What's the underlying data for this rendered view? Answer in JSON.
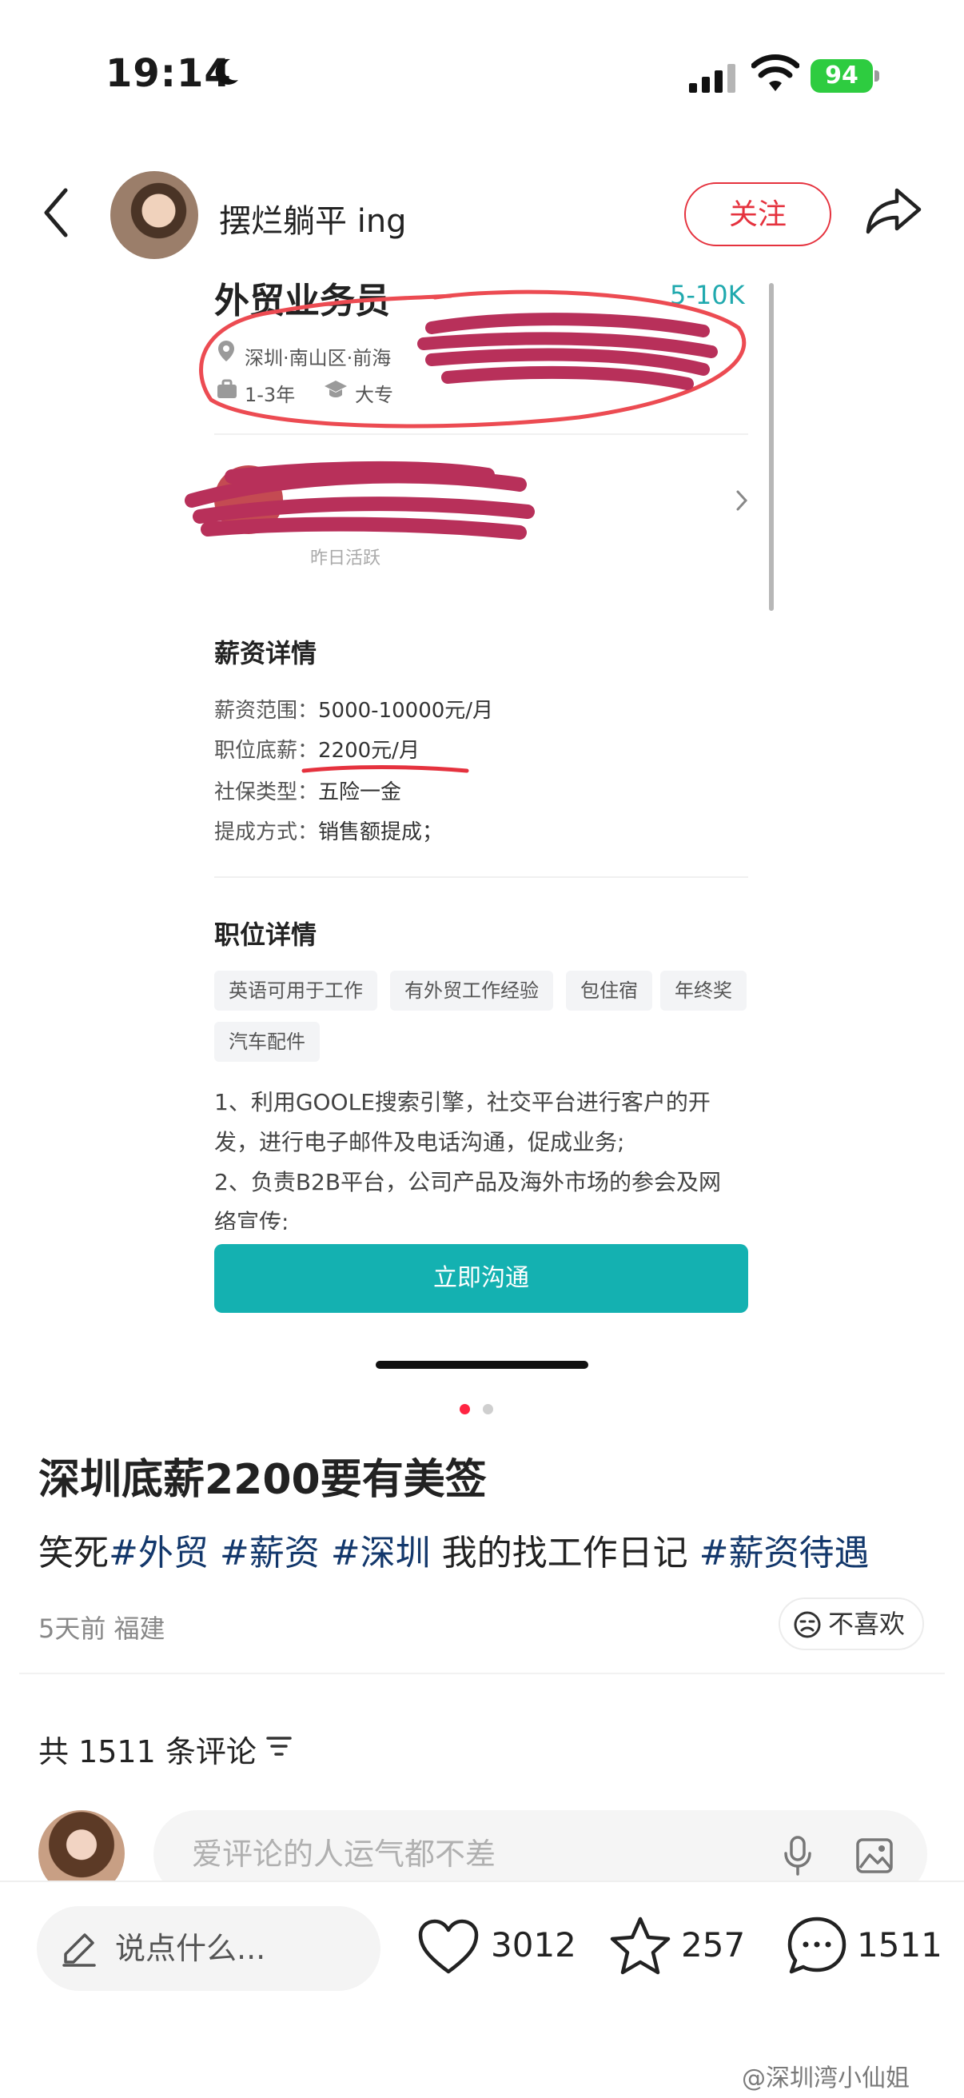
{
  "status_bar": {
    "time": "19:14",
    "battery": "94"
  },
  "header": {
    "author": "摆烂躺平 ing",
    "follow_label": "关注"
  },
  "job_card": {
    "title": "外贸业务员",
    "salary": "5-10K",
    "location": "深圳·南山区·前海",
    "experience": "1-3年",
    "education": "大专",
    "recruiter_status": "昨日活跃",
    "salary_section": {
      "heading": "薪资详情",
      "rows": [
        {
          "label": "薪资范围：",
          "value": "5000-10000元/月"
        },
        {
          "label": "职位底薪：",
          "value": "2200元/月"
        },
        {
          "label": "社保类型：",
          "value": "五险一金"
        },
        {
          "label": "提成方式：",
          "value": "销售额提成；"
        }
      ]
    },
    "detail_section": {
      "heading": "职位详情",
      "tags": [
        "英语可用于工作",
        "有外贸工作经验",
        "包住宿",
        "年终奖",
        "汽车配件"
      ],
      "description_lines": [
        "1、利用GOOLE搜索引擎，社交平台进行客户的开",
        "发，进行电子邮件及电话沟通，促成业务;",
        "2、负责B2B平台，公司产品及海外市场的参会及网",
        "络宣传;"
      ]
    },
    "chat_button": "立即沟通"
  },
  "post": {
    "title": "深圳底薪2200要有美签",
    "body_prefix": "笑死",
    "hashtags": [
      "#外贸",
      "#薪资",
      "#深圳"
    ],
    "body_middle": "我的找工作日记",
    "hashtag_last": "#薪资待遇",
    "meta": "5天前 福建",
    "dislike_label": "不喜欢"
  },
  "comments": {
    "count_label": "共 1511 条评论",
    "input_placeholder": "爱评论的人运气都不差"
  },
  "bottom_bar": {
    "say_placeholder": "说点什么...",
    "likes": "3012",
    "favorites": "257",
    "comments": "1511"
  },
  "watermark": "@深圳湾小仙姐",
  "colors": {
    "accent_red": "#e5323e",
    "teal": "#14b1b1",
    "hashtag": "#13386c",
    "scribble": "#b8305a"
  }
}
